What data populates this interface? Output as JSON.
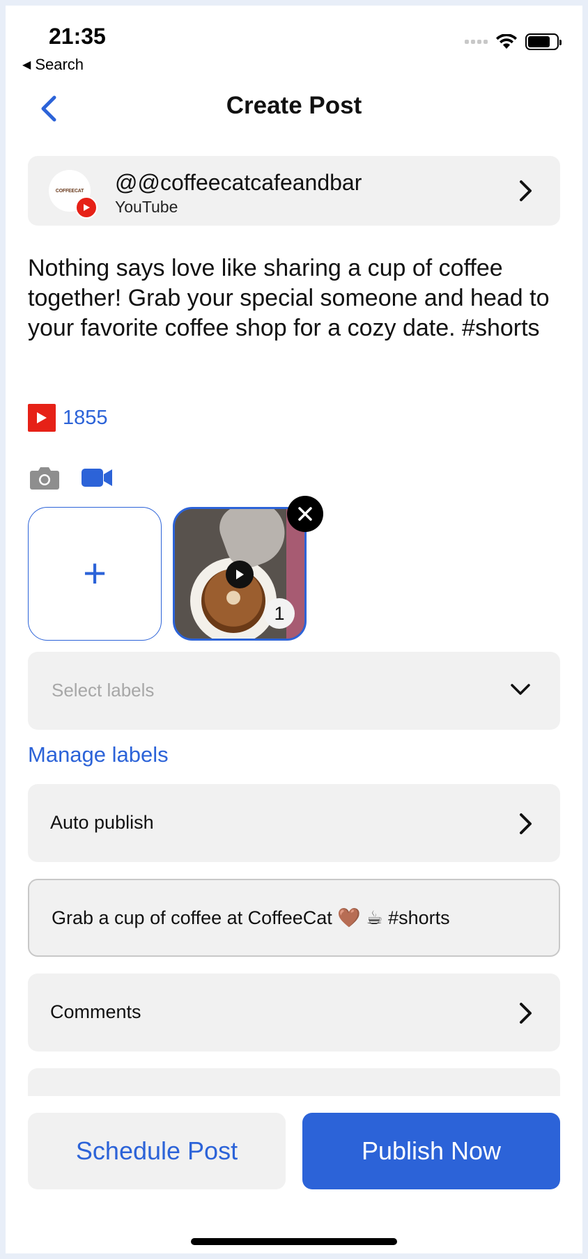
{
  "status_bar": {
    "time": "21:35",
    "back_app": "Search",
    "icons": [
      "signal-icon",
      "wifi-icon",
      "battery-icon"
    ]
  },
  "header": {
    "title": "Create Post",
    "back_icon": "chevron-left-icon"
  },
  "account": {
    "name": "@@coffeecatcafeandbar",
    "platform": "YouTube",
    "avatar_text": "COFFEECAT"
  },
  "post": {
    "text": "Nothing says love like sharing a cup of coffee together! Grab your special someone and head to your favorite coffee shop for a cozy date. #shorts",
    "char_count": "1855"
  },
  "media": {
    "types": [
      "camera-icon",
      "video-icon"
    ],
    "add_label": "+",
    "thumbnail_index": "1"
  },
  "labels": {
    "placeholder": "Select labels",
    "manage_link": "Manage labels"
  },
  "settings": {
    "auto_publish": "Auto publish",
    "title_value": "Grab a cup of coffee at CoffeeCat 🤎 ☕ #shorts",
    "comments": "Comments"
  },
  "actions": {
    "schedule": "Schedule Post",
    "publish": "Publish Now"
  },
  "colors": {
    "accent": "#2c63d8",
    "youtube_red": "#e62117",
    "card_bg": "#f1f1f1"
  }
}
